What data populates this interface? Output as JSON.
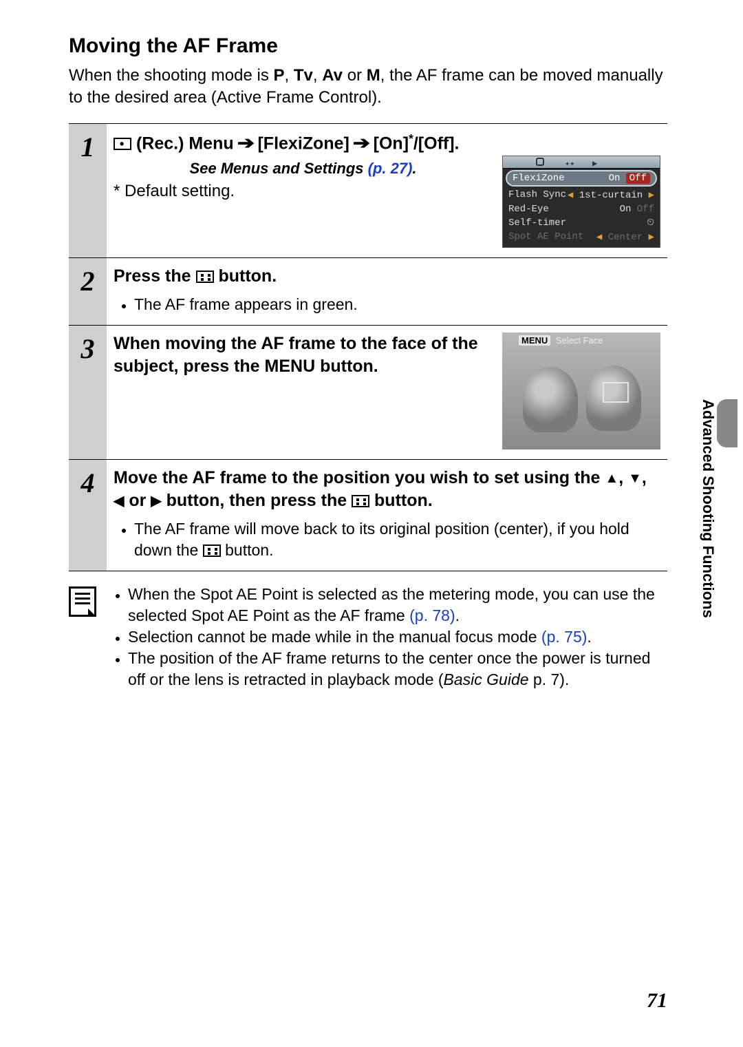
{
  "page": {
    "title": "Moving the AF Frame",
    "intro_parts": {
      "p1": "When the shooting mode is ",
      "mP": "P",
      "c1": ", ",
      "mTv": "Tv",
      "c2": ", ",
      "mAv": "Av",
      "c3": " or ",
      "mM": "M",
      "p2": ", the AF frame can be moved manually to the desired area (Active Frame Control)."
    },
    "side_tab": "Advanced Shooting Functions",
    "page_number": "71"
  },
  "steps": {
    "s1": {
      "num": "1",
      "heading_parts": {
        "a": " (Rec.) Menu ",
        "b": " [FlexiZone] ",
        "c": " [On]",
        "sup": "*",
        "d": "/[Off]."
      },
      "see_menus": "See Menus and Settings ",
      "see_menus_ref": "(p. 27)",
      "see_menus_dot": ".",
      "default_note": "* Default setting.",
      "menu": {
        "r1": {
          "label": "FlexiZone",
          "val_on": "On",
          "val_off": "Off"
        },
        "r2": {
          "label": "Flash Sync",
          "val": "1st-curtain"
        },
        "r3": {
          "label": "Red-Eye",
          "val_on": "On",
          "val_off": "Off"
        },
        "r4": {
          "label": "Self-timer",
          "val": "⏲"
        },
        "r5": {
          "label": "Spot AE Point",
          "val": "Center"
        }
      }
    },
    "s2": {
      "num": "2",
      "heading_a": "Press the ",
      "heading_b": " button.",
      "bullet": "The AF frame appears in green."
    },
    "s3": {
      "num": "3",
      "heading": "When moving the AF frame to the face of the subject, press the MENU button.",
      "shot_label_menu": "MENU",
      "shot_label_text": " Select Face"
    },
    "s4": {
      "num": "4",
      "heading_a": "Move the AF frame to the position you wish to set using the ",
      "heading_mid": " or ",
      "heading_b": " button, then press the ",
      "heading_c": " button.",
      "bullet_a": "The AF frame will move back to its original position (center), if you hold down the ",
      "bullet_b": " button."
    }
  },
  "notes": {
    "n1a": "When the Spot AE Point is selected as the metering mode, you can use the selected Spot AE Point as the AF frame ",
    "n1ref": "(p. 78)",
    "dot": ".",
    "n2a": "Selection cannot be made while in the manual focus mode ",
    "n2ref": "(p. 75)",
    "n3a": "The position of the AF frame returns to the center once the power is turned off or the lens is retracted in playback mode (",
    "n3i": "Basic Guide",
    "n3b": " p. 7)."
  }
}
